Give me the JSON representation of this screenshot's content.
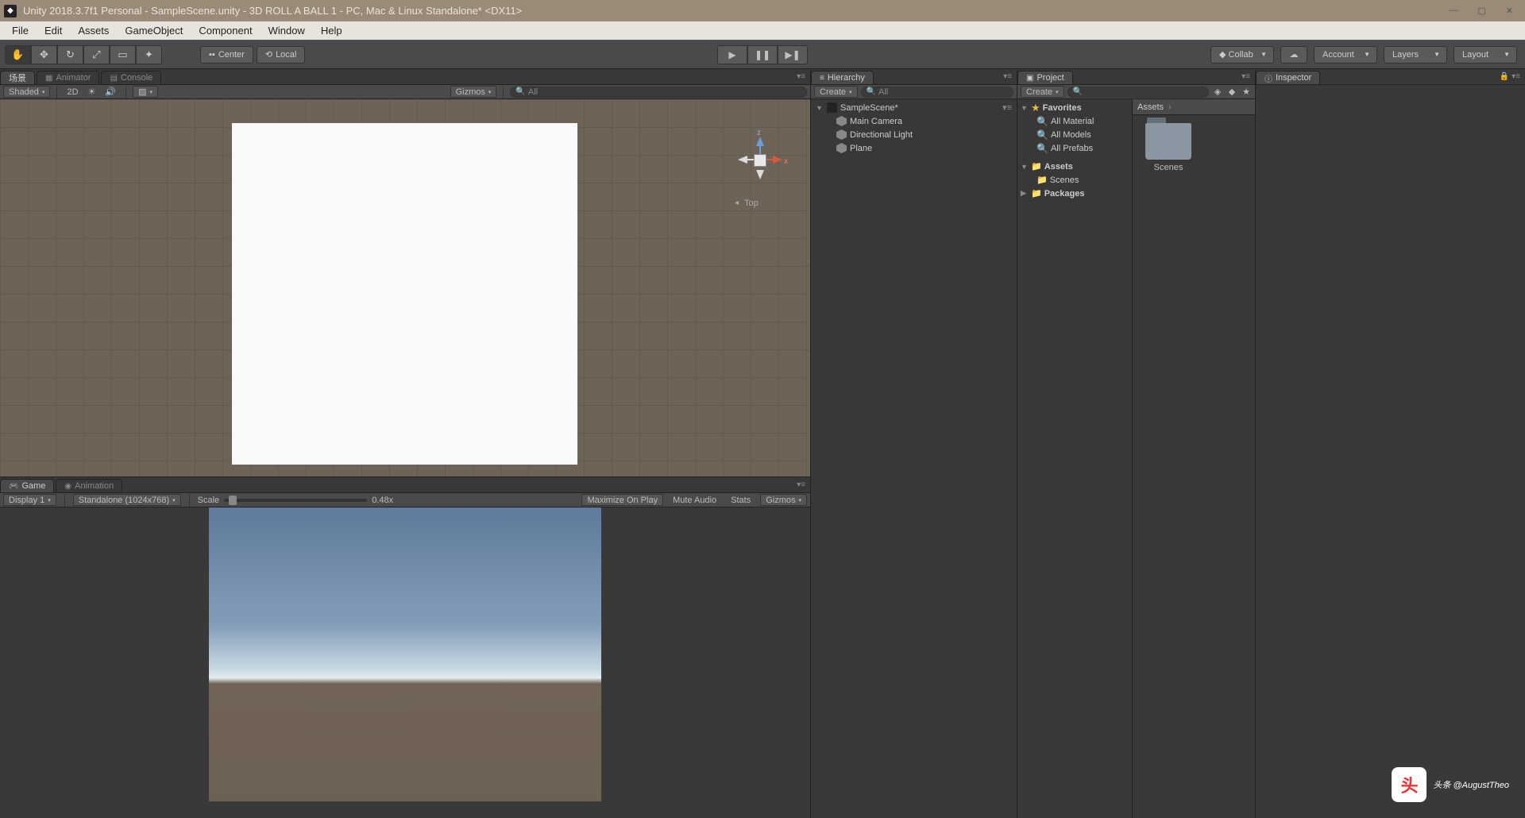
{
  "window": {
    "title": "Unity 2018.3.7f1 Personal - SampleScene.unity - 3D ROLL A BALL 1 - PC, Mac & Linux Standalone* <DX11>"
  },
  "menubar": [
    "File",
    "Edit",
    "Assets",
    "GameObject",
    "Component",
    "Window",
    "Help"
  ],
  "toolbar": {
    "pivot": "Center",
    "handle": "Local",
    "collab": "Collab",
    "account": "Account",
    "layers": "Layers",
    "layout": "Layout"
  },
  "scene": {
    "tab": "场景",
    "animator_tab": "Animator",
    "console_tab": "Console",
    "shading": "Shaded",
    "mode2d": "2D",
    "gizmos": "Gizmos",
    "search_placeholder": "All",
    "axis_z": "z",
    "axis_x": "x",
    "view_label": "Top"
  },
  "game": {
    "tab": "Game",
    "animation_tab": "Animation",
    "display": "Display 1",
    "aspect": "Standalone (1024x768)",
    "scale_label": "Scale",
    "scale_value": "0.48x",
    "maximize": "Maximize On Play",
    "mute": "Mute Audio",
    "stats": "Stats",
    "gizmos": "Gizmos"
  },
  "hierarchy": {
    "tab": "Hierarchy",
    "create": "Create",
    "search_placeholder": "All",
    "scene_name": "SampleScene*",
    "items": [
      "Main Camera",
      "Directional Light",
      "Plane"
    ]
  },
  "project": {
    "tab": "Project",
    "create": "Create",
    "favorites": "Favorites",
    "fav_items": [
      "All Material",
      "All Models",
      "All Prefabs"
    ],
    "assets": "Assets",
    "scenes": "Scenes",
    "packages": "Packages",
    "breadcrumb": "Assets",
    "folder_label": "Scenes"
  },
  "inspector": {
    "tab": "Inspector"
  },
  "watermark": {
    "text": "头条 @AugustTheo"
  }
}
